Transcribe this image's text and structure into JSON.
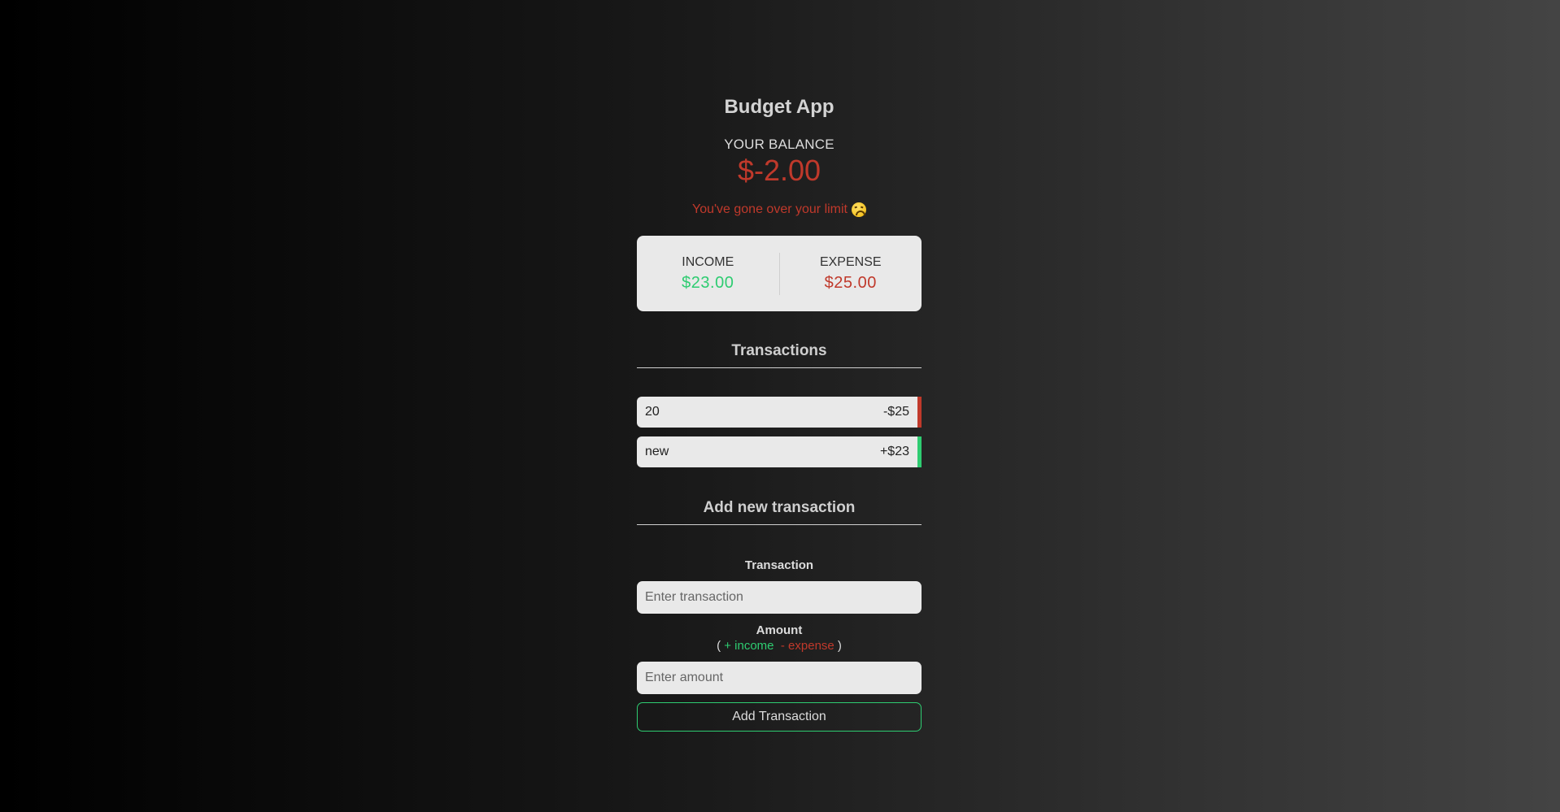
{
  "app": {
    "title": "Budget App"
  },
  "balance": {
    "label": "YOUR BALANCE",
    "value": "$-2.00",
    "limit_message": "You've gone over your limit",
    "limit_icon": "tired-face-emoji"
  },
  "summary": {
    "income_label": "INCOME",
    "income_value": "$23.00",
    "expense_label": "EXPENSE",
    "expense_value": "$25.00"
  },
  "transactions": {
    "title": "Transactions",
    "items": [
      {
        "name": "20",
        "amount": "-$25",
        "type": "minus"
      },
      {
        "name": "new",
        "amount": "+$23",
        "type": "plus"
      }
    ]
  },
  "form": {
    "title": "Add new transaction",
    "transaction_label": "Transaction",
    "transaction_placeholder": "Enter transaction",
    "amount_label": "Amount",
    "hint_open": "(",
    "hint_income": "+ income",
    "hint_expense": "- expense",
    "hint_close": ")",
    "amount_placeholder": "Enter amount",
    "submit_label": "Add Transaction"
  },
  "colors": {
    "negative": "#c0392b",
    "positive": "#2ecc71",
    "card_bg": "#e9e9e9"
  }
}
